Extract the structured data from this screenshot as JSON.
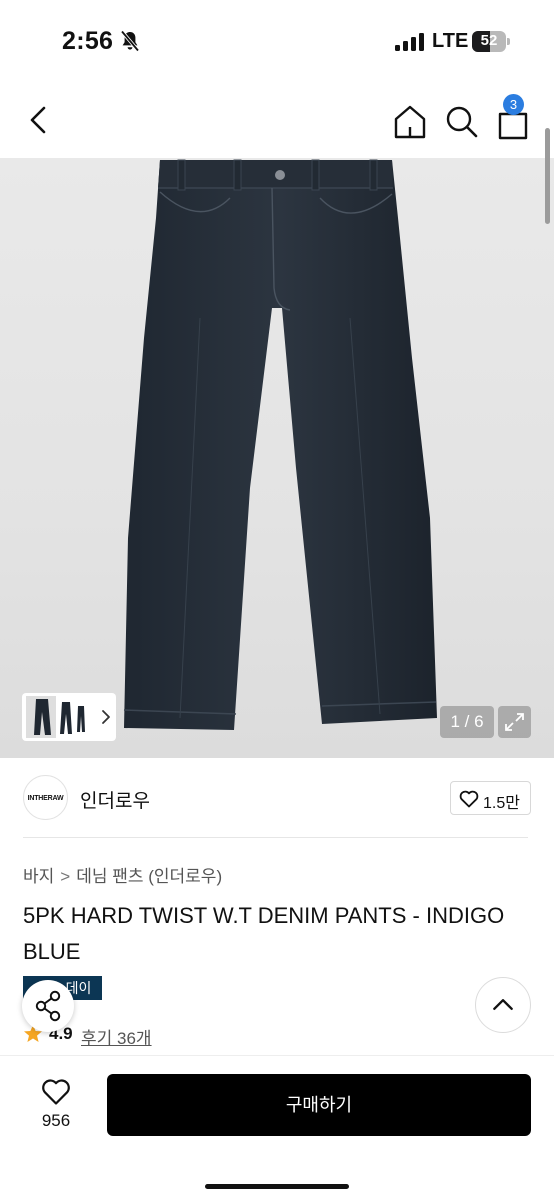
{
  "status_bar": {
    "time": "2:56",
    "network": "LTE",
    "battery_percent": 52,
    "battery_label": "52"
  },
  "nav": {
    "cart_count": "3",
    "icons": [
      "back-chevron-icon",
      "home-icon",
      "search-icon",
      "shopping-bag-icon"
    ]
  },
  "gallery": {
    "counter": "1 / 6",
    "current_image": 1,
    "total_images": 6
  },
  "brand": {
    "logo_text": "INTHERAW",
    "name": "인더로우",
    "likes": "1.5만"
  },
  "product": {
    "breadcrumb": [
      "바지",
      "데님 팬츠 (인더로우)"
    ],
    "breadcrumb_separator": ">",
    "title": "5PK HARD TWIST W.T DENIM PANTS - INDIGO BLUE",
    "event_badge_visible": "데이",
    "rating": "4.9",
    "reviews_label": "후기 36개"
  },
  "bottom_bar": {
    "wish_count": "956",
    "buy_label": "구매하기"
  },
  "colors": {
    "accent_blue": "#2b7de0",
    "badge_navy": "#0c3654",
    "star_orange": "#f5a623",
    "buy_black": "#000000"
  }
}
